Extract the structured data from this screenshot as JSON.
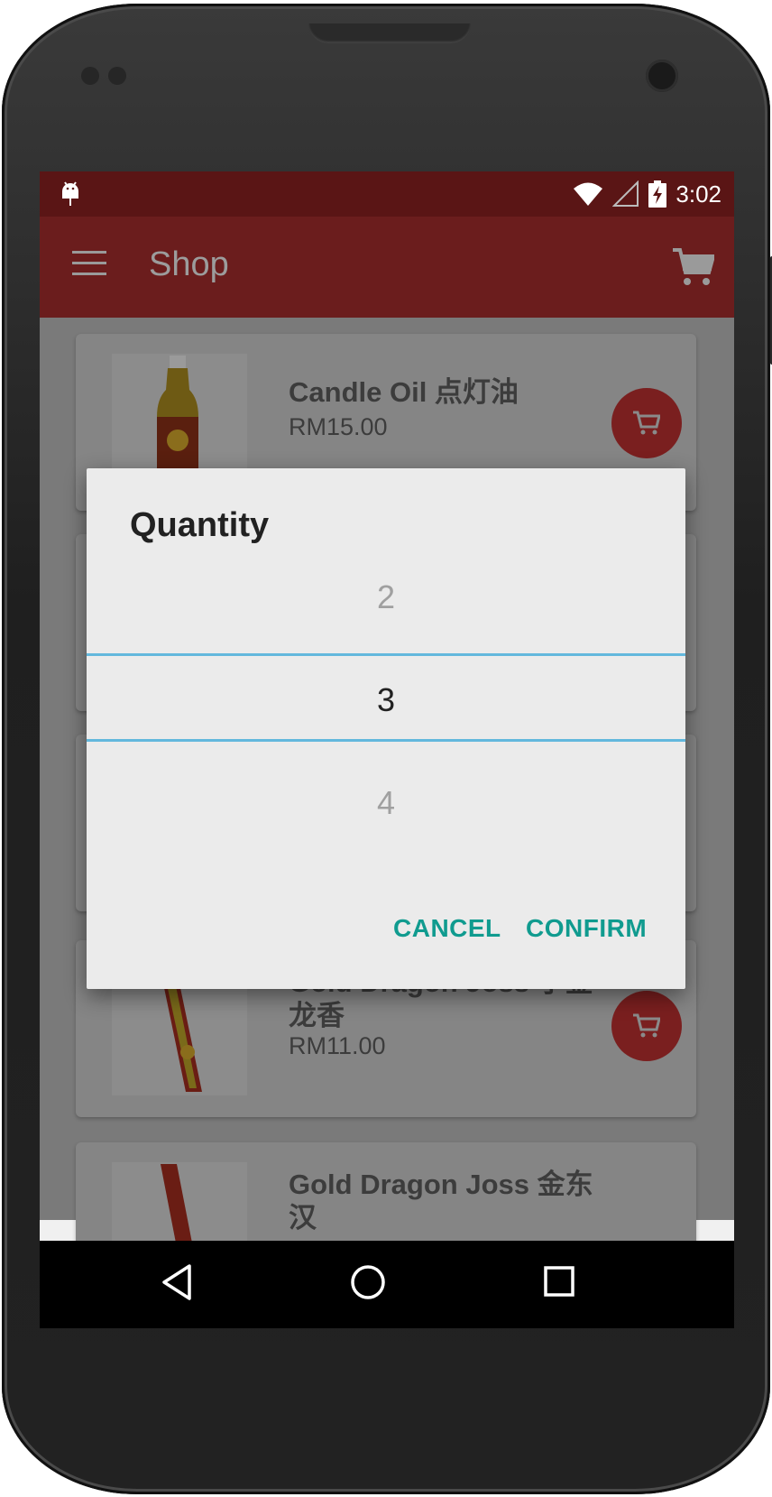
{
  "status_bar": {
    "time": "3:02",
    "icons": [
      "android-debug-icon",
      "wifi-icon",
      "signal-icon",
      "battery-charging-icon"
    ]
  },
  "app_bar": {
    "title": "Shop",
    "icons": [
      "menu-icon",
      "cart-icon"
    ]
  },
  "products": [
    {
      "name": "Candle Oil 点灯油",
      "price": "RM15.00"
    },
    {
      "name": "Gold Dragon Joss 小金龙香",
      "price": "RM11.00"
    },
    {
      "name": "Gold Dragon Joss 金东汉",
      "price": ""
    }
  ],
  "dialog": {
    "title": "Quantity",
    "picker": {
      "previous": "2",
      "selected": "3",
      "next": "4"
    },
    "cancel_label": "CANCEL",
    "confirm_label": "CONFIRM"
  },
  "colors": {
    "primary_dark": "#5a1515",
    "primary": "#6b1d1d",
    "accent_button": "#109b8f",
    "picker_divider": "#63b8dd"
  }
}
